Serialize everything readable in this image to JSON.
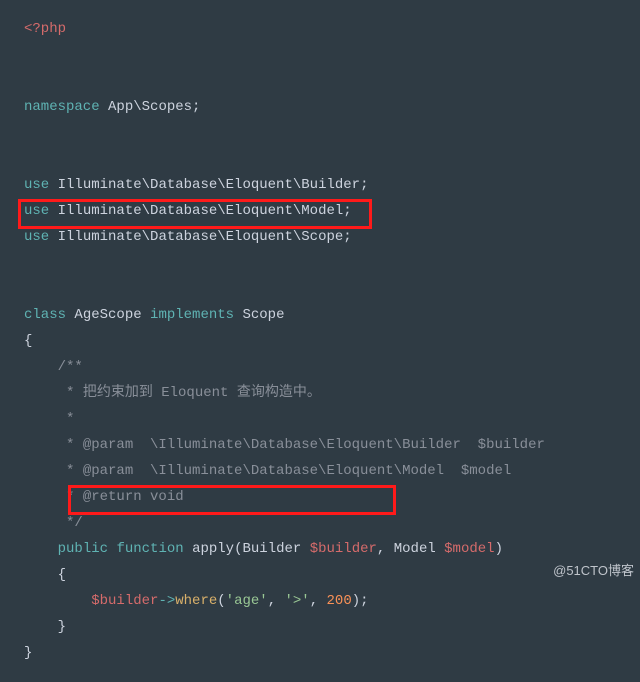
{
  "code": {
    "open_tag": "<?php",
    "ns_kw": "namespace",
    "ns_name": "App\\Scopes;",
    "use_kw": "use",
    "use1": "Illuminate\\Database\\Eloquent\\Builder;",
    "use2": "Illuminate\\Database\\Eloquent\\Model;",
    "use3": "Illuminate\\Database\\Eloquent\\Scope;",
    "class_kw": "class",
    "class_name": "AgeScope",
    "impl_kw": "implements",
    "impl_name": "Scope",
    "brace_open": "{",
    "c1": "/**",
    "c2": " * 把约束加到 Eloquent 查询构造中。",
    "c3": " *",
    "c4": " * @param  \\Illuminate\\Database\\Eloquent\\Builder  $builder",
    "c5": " * @param  \\Illuminate\\Database\\Eloquent\\Model  $model",
    "c6": " * @return void",
    "c7": " */",
    "public_kw": "public",
    "func_kw": "function",
    "func_name": "apply",
    "paren_open": "(",
    "type_builder": "Builder",
    "var_builder": "$builder",
    "comma": ",",
    "type_model": "Model",
    "var_model": "$model",
    "paren_close": ")",
    "arrow": "->",
    "method": "where",
    "arg1": "'age'",
    "arg2": "'>'",
    "arg3": "200",
    "stmt_end": ");",
    "brace_close": "}",
    "brace_close2": "}"
  },
  "watermark": "@51CTO博客"
}
